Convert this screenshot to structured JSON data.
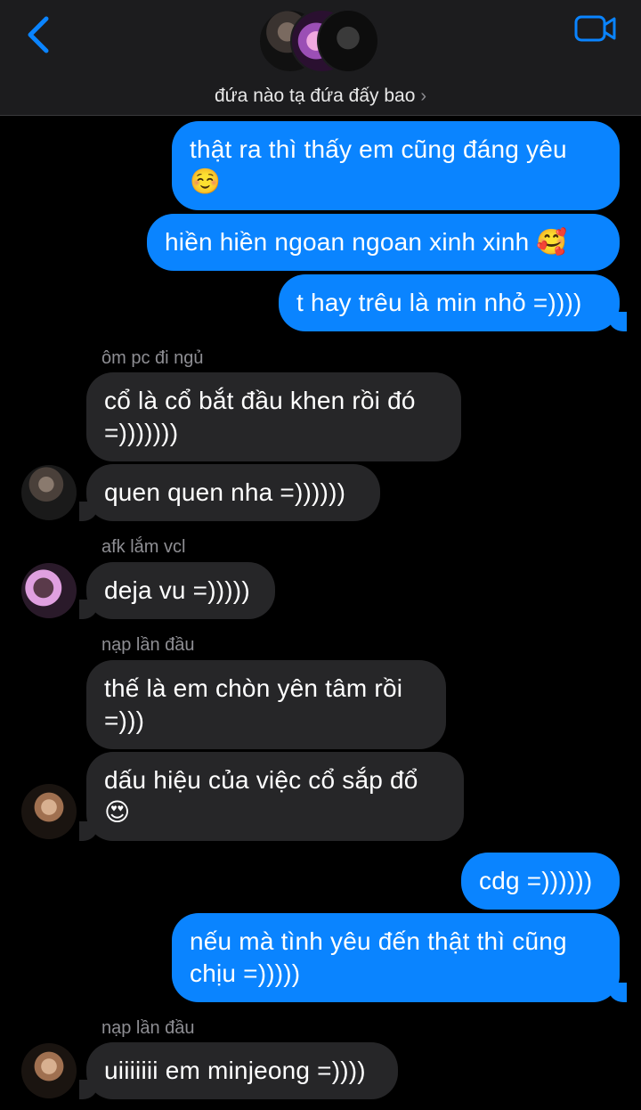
{
  "header": {
    "title": "đứa nào tạ đứa đấy bao",
    "title_chevron": "›",
    "back_icon": "chevron-left-icon",
    "video_icon": "video-camera-icon",
    "accent_color": "#0a84ff"
  },
  "messages": [
    {
      "dir": "out",
      "text": "thật ra thì thấy em cũng đáng yêu",
      "emoji": "☺️"
    },
    {
      "dir": "out",
      "text": "hiền hiền ngoan ngoan xinh xinh",
      "emoji": "🥰"
    },
    {
      "dir": "out",
      "text": "t hay trêu là min nhỏ =))))"
    },
    {
      "dir": "in",
      "sender": "ôm pc đi ngủ",
      "text": "cổ là cổ bắt đầu khen rồi đó =)))))))"
    },
    {
      "dir": "in",
      "text": "quen quen nha =))))))"
    },
    {
      "dir": "in",
      "sender": "afk lắm vcl",
      "text": "deja vu =)))))"
    },
    {
      "dir": "in",
      "sender": "nạp lần đầu",
      "text": "thế là em chòn yên tâm rồi =)))"
    },
    {
      "dir": "in",
      "text": "dấu hiệu của việc cổ sắp đổ",
      "emoji": "😍"
    },
    {
      "dir": "out",
      "text": "cdg =))))))"
    },
    {
      "dir": "out",
      "text": "nếu mà tình yêu đến thật thì cũng chịu =)))))"
    },
    {
      "dir": "in",
      "sender": "nạp lần đầu",
      "text": "uiiiiiii em minjeong =))))"
    }
  ]
}
